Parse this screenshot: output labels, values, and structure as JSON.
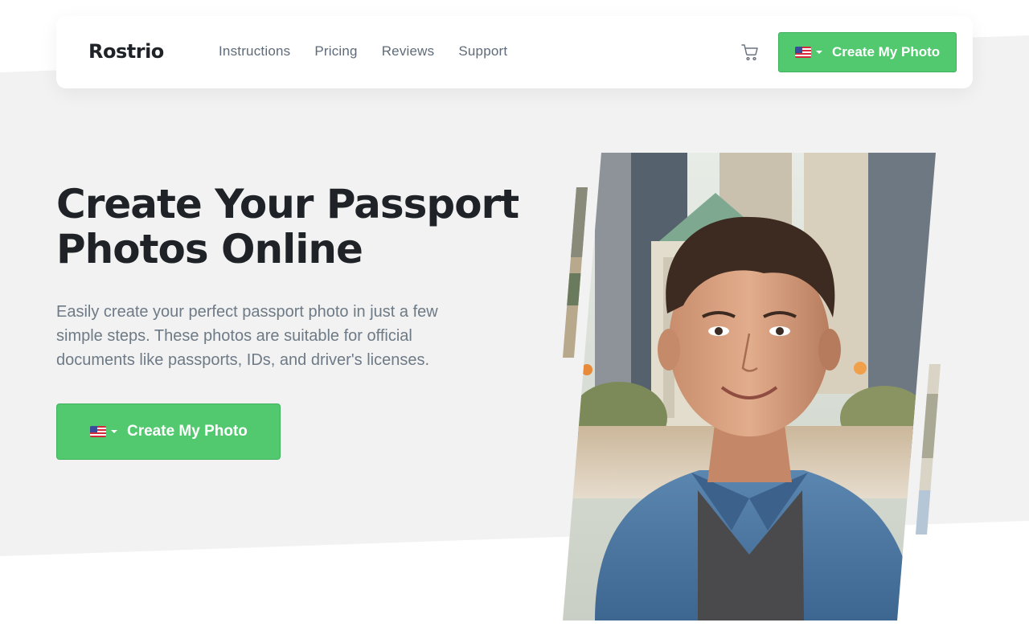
{
  "header": {
    "logo": "Rostrio",
    "nav": [
      "Instructions",
      "Pricing",
      "Reviews",
      "Support"
    ],
    "cta_label": "Create My Photo",
    "cta_flag": "us-flag-icon"
  },
  "hero": {
    "title_line1": "Create Your Passport",
    "title_line2": "Photos Online",
    "subtitle": "Easily create your perfect passport photo in just a few simple steps. These photos are suitable for official documents like passports, IDs, and driver's licenses.",
    "cta_label": "Create My Photo",
    "cta_flag": "us-flag-icon"
  },
  "colors": {
    "accent_green": "#52c96f",
    "background_grey": "#f1f2f1",
    "heading": "#1f2328",
    "body_text": "#6e7a86"
  },
  "icons": {
    "cart": "cart-icon",
    "dropdown": "caret-down-icon"
  }
}
